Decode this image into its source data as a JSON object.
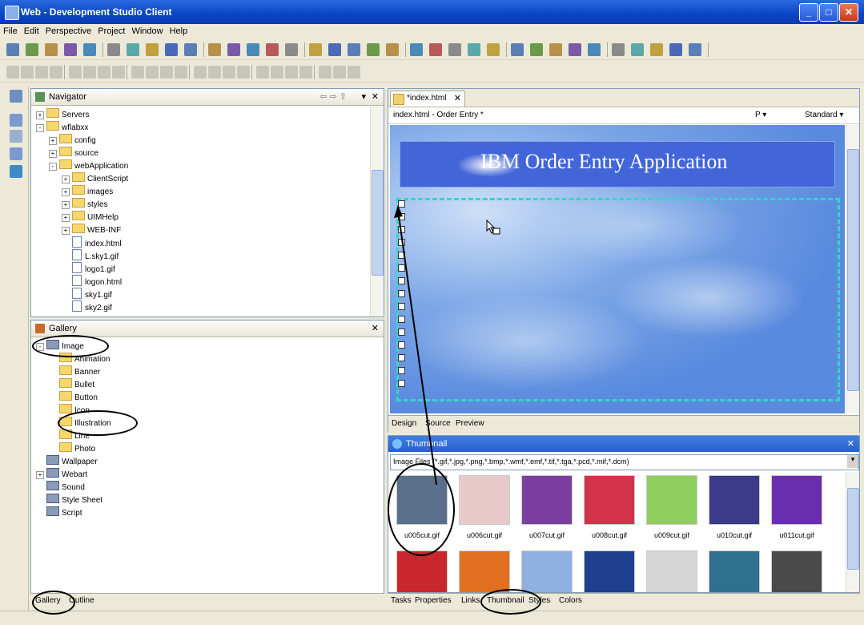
{
  "window": {
    "title": "Web - Development Studio Client"
  },
  "menu": [
    "File",
    "Edit",
    "Perspective",
    "Project",
    "Window",
    "Help"
  ],
  "navigator": {
    "title": "Navigator",
    "items": [
      {
        "label": "Servers",
        "type": "folder",
        "level": 0,
        "toggle": "+"
      },
      {
        "label": "wflabxx",
        "type": "folder",
        "level": 0,
        "toggle": "-"
      },
      {
        "label": "config",
        "type": "folder",
        "level": 1,
        "toggle": "+"
      },
      {
        "label": "source",
        "type": "folder",
        "level": 1,
        "toggle": "+"
      },
      {
        "label": "webApplication",
        "type": "folder",
        "level": 1,
        "toggle": "-"
      },
      {
        "label": "ClientScript",
        "type": "folder",
        "level": 2,
        "toggle": "+"
      },
      {
        "label": "images",
        "type": "folder",
        "level": 2,
        "toggle": "+"
      },
      {
        "label": "styles",
        "type": "folder",
        "level": 2,
        "toggle": "+"
      },
      {
        "label": "UIMHelp",
        "type": "folder",
        "level": 2,
        "toggle": "+"
      },
      {
        "label": "WEB-INF",
        "type": "folder",
        "level": 2,
        "toggle": "+"
      },
      {
        "label": "index.html",
        "type": "file",
        "level": 2,
        "toggle": ""
      },
      {
        "label": "L.sky1.gif",
        "type": "file",
        "level": 2,
        "toggle": ""
      },
      {
        "label": "logo1.gif",
        "type": "file",
        "level": 2,
        "toggle": ""
      },
      {
        "label": "logon.html",
        "type": "file",
        "level": 2,
        "toggle": ""
      },
      {
        "label": "sky1.gif",
        "type": "file",
        "level": 2,
        "toggle": ""
      },
      {
        "label": "sky2.gif",
        "type": "file",
        "level": 2,
        "toggle": ""
      }
    ]
  },
  "gallery": {
    "title": "Gallery",
    "items": [
      {
        "label": "Image",
        "type": "image",
        "level": 0,
        "toggle": "-"
      },
      {
        "label": "Animation",
        "type": "folder",
        "level": 1,
        "toggle": ""
      },
      {
        "label": "Banner",
        "type": "folder",
        "level": 1,
        "toggle": ""
      },
      {
        "label": "Bullet",
        "type": "folder",
        "level": 1,
        "toggle": ""
      },
      {
        "label": "Button",
        "type": "folder",
        "level": 1,
        "toggle": ""
      },
      {
        "label": "Icon",
        "type": "folder",
        "level": 1,
        "toggle": ""
      },
      {
        "label": "Illustration",
        "type": "folder",
        "level": 1,
        "toggle": ""
      },
      {
        "label": "Line",
        "type": "folder",
        "level": 1,
        "toggle": ""
      },
      {
        "label": "Photo",
        "type": "folder",
        "level": 1,
        "toggle": ""
      },
      {
        "label": "Wallpaper",
        "type": "wall",
        "level": 0,
        "toggle": ""
      },
      {
        "label": "Webart",
        "type": "webart",
        "level": 0,
        "toggle": "+"
      },
      {
        "label": "Sound",
        "type": "sound",
        "level": 0,
        "toggle": ""
      },
      {
        "label": "Style Sheet",
        "type": "css",
        "level": 0,
        "toggle": ""
      },
      {
        "label": "Script",
        "type": "script",
        "level": 0,
        "toggle": ""
      }
    ],
    "tabs": [
      "Gallery",
      "Outline"
    ]
  },
  "editor": {
    "tab": "*index.html",
    "header": "index.html - Order Entry *",
    "format": "P",
    "style": "Standard",
    "banner": "IBM Order Entry Application",
    "tabs": [
      "Design",
      "Source",
      "Preview"
    ]
  },
  "thumbnail": {
    "title": "Thumbnail",
    "filter": "Image Files (*.gif,*.jpg,*.png,*.bmp,*.wmf,*.emf,*.tif,*.tga,*.pcd,*.mif,*.dcm)",
    "items": [
      {
        "label": "u005cut.gif",
        "color": "#5a6f8a"
      },
      {
        "label": "u006cut.gif",
        "color": "#e8c9c9"
      },
      {
        "label": "u007cut.gif",
        "color": "#7a3fa0"
      },
      {
        "label": "u008cut.gif",
        "color": "#d2334a"
      },
      {
        "label": "u009cut.gif",
        "color": "#8fcf5f"
      },
      {
        "label": "u010cut.gif",
        "color": "#3b3b8a"
      },
      {
        "label": "u011cut.gif",
        "color": "#6a2fb0"
      }
    ],
    "row2": [
      "#c8282d",
      "#e07020",
      "#8fb0e0",
      "#1f3f8f",
      "#d6d6d6",
      "#2f6f8f",
      "#4a4a4a"
    ],
    "tabs": [
      "Tasks",
      "Properties",
      "Links",
      "Thumbnail",
      "Styles",
      "Colors"
    ]
  }
}
